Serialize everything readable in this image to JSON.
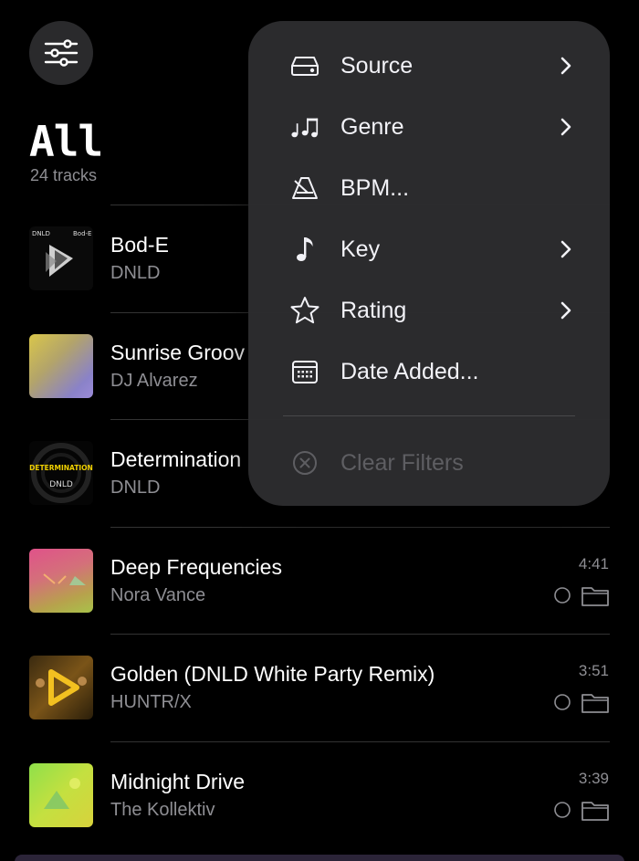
{
  "header": {
    "filter_button_icon": "sliders-icon",
    "title": "All",
    "subtitle": "24 tracks"
  },
  "tracks": [
    {
      "title": "Bod-E",
      "artist": "DNLD",
      "duration": "",
      "art": "bod-e-cover"
    },
    {
      "title": "Sunrise Groov",
      "artist": "DJ Alvarez",
      "duration": "",
      "art": "gradient-yellow-purple"
    },
    {
      "title": "Determination",
      "artist": "DNLD",
      "duration": "",
      "art": "determination-cover"
    },
    {
      "title": "Deep Frequencies",
      "artist": "Nora Vance",
      "duration": "4:41",
      "art": "gradient-pink-green"
    },
    {
      "title": "Golden (DNLD White Party Remix)",
      "artist": "HUNTR/X",
      "duration": "3:51",
      "art": "golden-cover"
    },
    {
      "title": "Midnight Drive",
      "artist": "The Kollektiv",
      "duration": "3:39",
      "art": "gradient-green-yellow"
    }
  ],
  "menu": {
    "items": [
      {
        "label": "Source",
        "icon": "drive-icon",
        "has_submenu": true
      },
      {
        "label": "Genre",
        "icon": "music-notes-icon",
        "has_submenu": true
      },
      {
        "label": "BPM...",
        "icon": "metronome-icon",
        "has_submenu": false
      },
      {
        "label": "Key",
        "icon": "music-note-icon",
        "has_submenu": true
      },
      {
        "label": "Rating",
        "icon": "star-icon",
        "has_submenu": true
      },
      {
        "label": "Date Added...",
        "icon": "calendar-icon",
        "has_submenu": false
      }
    ],
    "clear": {
      "label": "Clear Filters",
      "icon": "x-circle-icon",
      "disabled": true
    }
  },
  "colors": {
    "background": "#000000",
    "menu_background": "#2c2c2e",
    "secondary_text": "#8e8e93"
  }
}
